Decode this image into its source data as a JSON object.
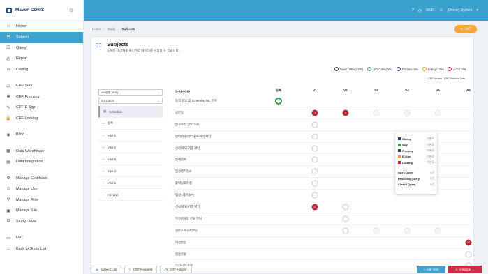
{
  "brand": {
    "name": "Maven CDMS"
  },
  "sidebar": {
    "items": [
      {
        "label": "Home",
        "icon": "home-icon",
        "glyph": "⌂"
      },
      {
        "label": "Subject",
        "icon": "users-icon",
        "glyph": "☷",
        "active": true
      },
      {
        "label": "Query",
        "icon": "query-icon",
        "glyph": "☐"
      },
      {
        "label": "Report",
        "icon": "report-icon",
        "glyph": "◴"
      },
      {
        "label": "Coding",
        "icon": "code-icon",
        "glyph": "‹›"
      },
      {
        "label": "CRF SDV",
        "icon": "sdv-icon",
        "glyph": "☑"
      },
      {
        "label": "CRF Freezing",
        "icon": "freeze-icon",
        "glyph": "✱"
      },
      {
        "label": "CRF E-Sign",
        "icon": "esign-icon",
        "glyph": "✎"
      },
      {
        "label": "CRF Locking",
        "icon": "lock-icon",
        "glyph": "🔒"
      },
      {
        "label": "Blind",
        "icon": "eye-icon",
        "glyph": "◉"
      },
      {
        "label": "Data Warehouse",
        "icon": "warehouse-icon",
        "glyph": "▦"
      },
      {
        "label": "Data Integration",
        "icon": "integration-icon",
        "glyph": "▤"
      },
      {
        "label": "Manage Certificate",
        "icon": "certificate-icon",
        "glyph": "⚙"
      },
      {
        "label": "Manage User",
        "icon": "user-icon",
        "glyph": "☺"
      },
      {
        "label": "Manage Role",
        "icon": "role-icon",
        "glyph": "⚲"
      },
      {
        "label": "Manage Site",
        "icon": "site-icon",
        "glyph": "▣"
      },
      {
        "label": "Study Close",
        "icon": "close-study-icon",
        "glyph": "⏻"
      },
      {
        "label": "UAT",
        "icon": "uat-icon",
        "glyph": "▭"
      },
      {
        "label": "Back to Study List",
        "icon": "back-icon",
        "glyph": "←"
      }
    ]
  },
  "topbar": {
    "time": "59:21",
    "user": "[Owner] System"
  },
  "breadcrumb": {
    "home": "Home",
    "study": "Study",
    "current": "Subjects"
  },
  "uat_button": "UAT",
  "page": {
    "title": "Subjects",
    "subtitle": "등록된 대상자를 확인하고 데이터를 수집할 수 있습니다."
  },
  "legend": {
    "save": "Save: 28%(12%)",
    "sdv": "SDV: 0%(0%)",
    "frozen": "Frozen: 0%",
    "esign": "E-Sign: 0%",
    "lock": "Lock: 0%",
    "note": "CRF Version | CRF Effective Date"
  },
  "filters": {
    "site": "****병원 (001)",
    "subject": "S-01-0019"
  },
  "visits": [
    "Schedule",
    "등록",
    "Visit 1",
    "Visit 2",
    "Visit 3",
    "Visit 4",
    "Visit 5",
    "AE Visit"
  ],
  "grid": {
    "subject_id": "S-01-0019",
    "columns": [
      "등록",
      "V1",
      "V2",
      "V3",
      "V4",
      "V5",
      "AE"
    ],
    "rows": [
      {
        "label": "동의 동의 및 Screening No. 부여",
        "cells": [
          "green",
          "",
          "",
          "",
          "",
          "",
          ""
        ]
      },
      {
        "label": "방문일",
        "cells": [
          "",
          "red",
          "red",
          "faint",
          "faint",
          "faint",
          ""
        ]
      },
      {
        "label": "인구학적 정보 조사",
        "cells": [
          "",
          "empty",
          "",
          "",
          "",
          "",
          ""
        ]
      },
      {
        "label": "병력/수술력/약물투여력 확인",
        "cells": [
          "",
          "empty",
          "",
          "",
          "",
          "",
          ""
        ]
      },
      {
        "label": "선정/제외 기준 확인",
        "cells": [
          "",
          "empty",
          "",
          "",
          "",
          "",
          ""
        ]
      },
      {
        "label": "신체검사",
        "cells": [
          "",
          "empty",
          "",
          "",
          "",
          "",
          ""
        ]
      },
      {
        "label": "임상병리검사",
        "cells": [
          "",
          "empty",
          "",
          "",
          "",
          "",
          ""
        ]
      },
      {
        "label": "활력징후측정",
        "cells": [
          "",
          "empty",
          "",
          "",
          "",
          "",
          ""
        ]
      },
      {
        "label": "임상시험약(IP)",
        "cells": [
          "",
          "empty",
          "",
          "",
          "",
          "",
          ""
        ]
      },
      {
        "label": "선정/제외 기준 확인",
        "cells": [
          "",
          "red",
          "empty",
          "",
          "",
          "",
          ""
        ]
      },
      {
        "label": "무작위배정 번호 부여",
        "cells": [
          "",
          "",
          "empty",
          "",
          "",
          "",
          ""
        ]
      },
      {
        "label": "설문조사 (eCOA)",
        "cells": [
          "",
          "",
          "empty",
          "faint",
          "faint",
          "faint",
          ""
        ]
      },
      {
        "label": "이상반응",
        "cells": [
          "",
          "",
          "",
          "",
          "",
          "",
          "red"
        ]
      },
      {
        "label": "병용약물",
        "cells": [
          "",
          "",
          "",
          "",
          "",
          "",
          "empty"
        ]
      },
      {
        "label": "임상시험 종료",
        "cells": [
          "",
          "",
          "",
          "",
          "",
          "",
          "empty"
        ]
      }
    ]
  },
  "popup": {
    "statuses": [
      {
        "label": "Saving",
        "value": "미완료",
        "color": "#2a3a5a"
      },
      {
        "label": "SDV",
        "value": "미완료",
        "color": "#2e9e4a"
      },
      {
        "label": "Freezing",
        "value": "미완료",
        "color": "#1f3b66"
      },
      {
        "label": "E-Sign",
        "value": "미완료",
        "color": "#f0a030"
      },
      {
        "label": "Locking",
        "value": "미완료",
        "color": "#b7283f"
      }
    ],
    "queries": [
      {
        "label": "Open Query",
        "value": "0건"
      },
      {
        "label": "Resolving Query",
        "value": "0건"
      },
      {
        "label": "Closed Query",
        "value": "0건"
      }
    ]
  },
  "bottom": {
    "subject_list": "Subject List",
    "crf_request": "CRF Request",
    "crf_history": "CRF History",
    "add_visit": "+ Add Visit",
    "initialize": "Initialize"
  }
}
